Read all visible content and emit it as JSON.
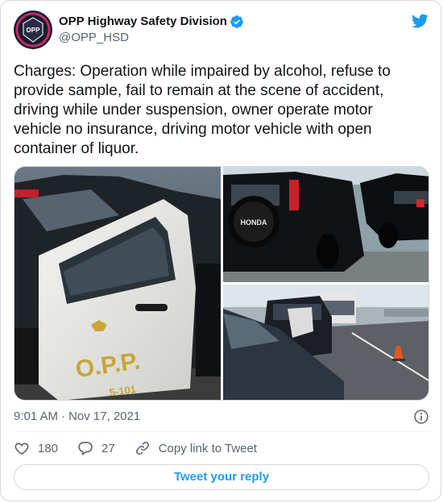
{
  "colors": {
    "accent": "#1d9bf0",
    "text": "#0f1419",
    "secondary": "#536471",
    "border": "#cfd9de"
  },
  "user": {
    "display_name": "OPP Highway Safety Division",
    "handle": "@OPP_HSD",
    "verified": true,
    "avatar_text": "OPP"
  },
  "tweet": {
    "text": "Charges: Operation while impaired by alcohol, refuse to provide sample, fail to remain at the scene of accident, driving while under suspension, owner operate motor vehicle no insurance, driving motor vehicle with open container of liquor.",
    "time": "9:01 AM",
    "separator": "·",
    "date": "Nov 17, 2021"
  },
  "media": {
    "left_photo": {
      "badge": "O.P.P.",
      "unit_number": "5-101"
    },
    "top_right_photo": {
      "spare_tire_brand": "HONDA"
    }
  },
  "actions": {
    "like_count": "180",
    "reply_count": "27",
    "copy_link_label": "Copy link to Tweet",
    "reply_button_label": "Tweet your reply"
  },
  "icons": [
    "verified-badge-icon",
    "twitter-bird-icon",
    "info-icon",
    "heart-icon",
    "reply-icon",
    "link-icon"
  ]
}
